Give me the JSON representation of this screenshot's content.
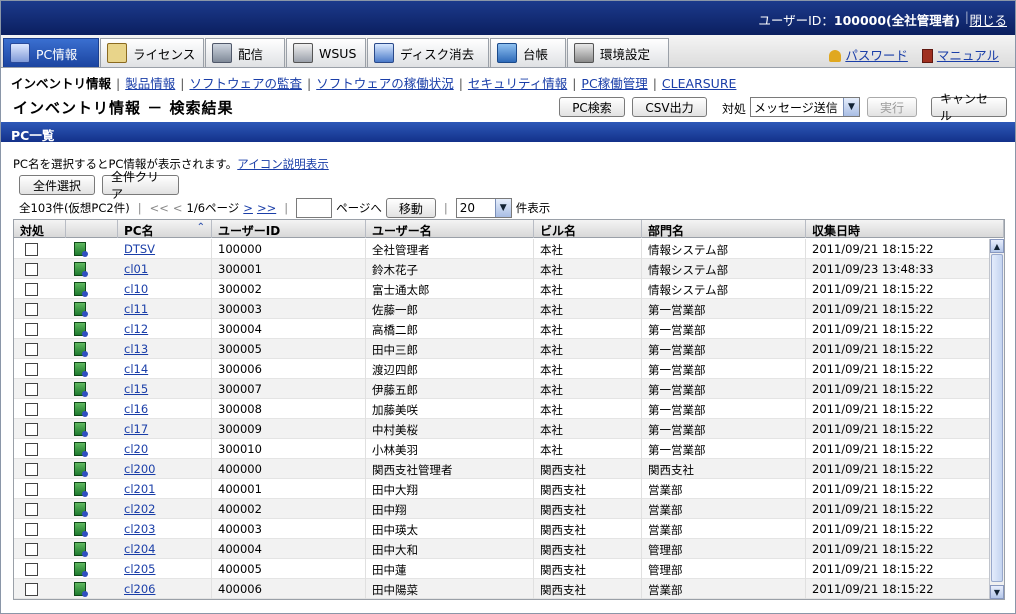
{
  "topbar": {
    "user_label": "ユーザーID：",
    "user_value": "100000(全社管理者)",
    "logout": "閉じる"
  },
  "tabs": [
    {
      "label": "PC情報",
      "icon": "pc-icon",
      "active": true
    },
    {
      "label": "ライセンス",
      "icon": "license-icon"
    },
    {
      "label": "配信",
      "icon": "distribution-icon"
    },
    {
      "label": "WSUS",
      "icon": "wsus-icon"
    },
    {
      "label": "ディスク消去",
      "icon": "disk-erase-icon"
    },
    {
      "label": "台帳",
      "icon": "ledger-icon"
    },
    {
      "label": "環境設定",
      "icon": "settings-icon"
    }
  ],
  "header_links": {
    "password": "パスワード",
    "manual": "マニュアル"
  },
  "subnav": {
    "current": "インベントリ情報",
    "links": [
      "製品情報",
      "ソフトウェアの監査",
      "ソフトウェアの稼働状況",
      "セキュリティ情報",
      "PC稼働管理",
      "CLEARSURE"
    ]
  },
  "page": {
    "title": "インベントリ情報 － 検索結果",
    "pc_search": "PC検索",
    "csv_output": "CSV出力",
    "action_label": "対処",
    "action_select": "メッセージ送信",
    "execute": "実行",
    "cancel": "キャンセル"
  },
  "section": {
    "title": "PC一覧"
  },
  "info": {
    "text": "PC名を選択するとPC情報が表示されます。",
    "link": "アイコン説明表示"
  },
  "buttons": {
    "select_all": "全件選択",
    "clear_all": "全件クリア"
  },
  "pager": {
    "count": "全103件(仮想PC2件)",
    "first": "<<",
    "prev": "<",
    "page": "1/6ページ",
    "next": ">",
    "last": ">>",
    "goto_suffix": "ページへ",
    "move": "移動",
    "per_page": "20",
    "per_page_suffix": "件表示"
  },
  "table": {
    "headers": [
      "対処",
      "",
      "PC名",
      "ユーザーID",
      "ユーザー名",
      "ビル名",
      "部門名",
      "収集日時"
    ],
    "rows": [
      {
        "pc": "DTSV",
        "uid": "100000",
        "name": "全社管理者",
        "bldg": "本社",
        "dept": "情報システム部",
        "date": "2011/09/21 18:15:22"
      },
      {
        "pc": "cl01",
        "uid": "300001",
        "name": "鈴木花子",
        "bldg": "本社",
        "dept": "情報システム部",
        "date": "2011/09/23 13:48:33"
      },
      {
        "pc": "cl10",
        "uid": "300002",
        "name": "富士通太郎",
        "bldg": "本社",
        "dept": "情報システム部",
        "date": "2011/09/21 18:15:22"
      },
      {
        "pc": "cl11",
        "uid": "300003",
        "name": "佐藤一郎",
        "bldg": "本社",
        "dept": "第一営業部",
        "date": "2011/09/21 18:15:22"
      },
      {
        "pc": "cl12",
        "uid": "300004",
        "name": "高橋二郎",
        "bldg": "本社",
        "dept": "第一営業部",
        "date": "2011/09/21 18:15:22"
      },
      {
        "pc": "cl13",
        "uid": "300005",
        "name": "田中三郎",
        "bldg": "本社",
        "dept": "第一営業部",
        "date": "2011/09/21 18:15:22"
      },
      {
        "pc": "cl14",
        "uid": "300006",
        "name": "渡辺四郎",
        "bldg": "本社",
        "dept": "第一営業部",
        "date": "2011/09/21 18:15:22"
      },
      {
        "pc": "cl15",
        "uid": "300007",
        "name": "伊藤五郎",
        "bldg": "本社",
        "dept": "第一営業部",
        "date": "2011/09/21 18:15:22"
      },
      {
        "pc": "cl16",
        "uid": "300008",
        "name": "加藤美咲",
        "bldg": "本社",
        "dept": "第一営業部",
        "date": "2011/09/21 18:15:22"
      },
      {
        "pc": "cl17",
        "uid": "300009",
        "name": "中村美桜",
        "bldg": "本社",
        "dept": "第一営業部",
        "date": "2011/09/21 18:15:22"
      },
      {
        "pc": "cl20",
        "uid": "300010",
        "name": "小林美羽",
        "bldg": "本社",
        "dept": "第一営業部",
        "date": "2011/09/21 18:15:22"
      },
      {
        "pc": "cl200",
        "uid": "400000",
        "name": "関西支社管理者",
        "bldg": "関西支社",
        "dept": "関西支社",
        "date": "2011/09/21 18:15:22"
      },
      {
        "pc": "cl201",
        "uid": "400001",
        "name": "田中大翔",
        "bldg": "関西支社",
        "dept": "営業部",
        "date": "2011/09/21 18:15:22"
      },
      {
        "pc": "cl202",
        "uid": "400002",
        "name": "田中翔",
        "bldg": "関西支社",
        "dept": "営業部",
        "date": "2011/09/21 18:15:22"
      },
      {
        "pc": "cl203",
        "uid": "400003",
        "name": "田中瑛太",
        "bldg": "関西支社",
        "dept": "営業部",
        "date": "2011/09/21 18:15:22"
      },
      {
        "pc": "cl204",
        "uid": "400004",
        "name": "田中大和",
        "bldg": "関西支社",
        "dept": "管理部",
        "date": "2011/09/21 18:15:22"
      },
      {
        "pc": "cl205",
        "uid": "400005",
        "name": "田中蓮",
        "bldg": "関西支社",
        "dept": "管理部",
        "date": "2011/09/21 18:15:22"
      },
      {
        "pc": "cl206",
        "uid": "400006",
        "name": "田中陽菜",
        "bldg": "関西支社",
        "dept": "営業部",
        "date": "2011/09/21 18:15:22"
      }
    ]
  }
}
